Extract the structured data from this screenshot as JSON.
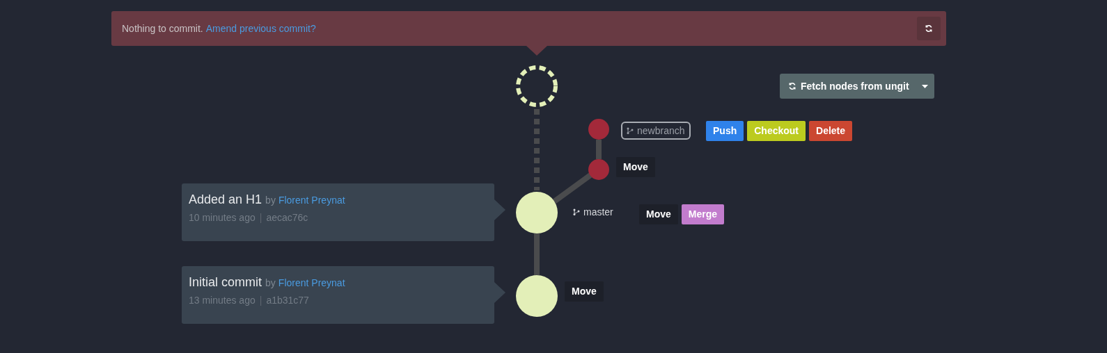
{
  "banner": {
    "text": "Nothing to commit.",
    "link": "Amend previous commit?"
  },
  "fetch_button": {
    "label": "Fetch nodes from ungit"
  },
  "nodes": [
    {
      "kind": "placeholder",
      "color": "#e3efb8"
    },
    {
      "kind": "commit",
      "color": "#a3293a"
    },
    {
      "kind": "commit",
      "color": "#a3293a"
    },
    {
      "kind": "commit",
      "color": "#e3efb8"
    },
    {
      "kind": "commit",
      "color": "#e3efb8"
    }
  ],
  "node_actions": [
    {
      "buttons": [
        {
          "kind": "move",
          "label": "Move"
        }
      ]
    },
    {
      "buttons": [
        {
          "kind": "move",
          "label": "Move"
        }
      ]
    }
  ],
  "branches": [
    {
      "name": "newbranch",
      "highlighted": true,
      "buttons": [
        {
          "kind": "push",
          "label": "Push"
        },
        {
          "kind": "checkout",
          "label": "Checkout"
        },
        {
          "kind": "delete",
          "label": "Delete"
        }
      ]
    },
    {
      "name": "master",
      "highlighted": false,
      "buttons": [
        {
          "kind": "move",
          "label": "Move"
        },
        {
          "kind": "merge",
          "label": "Merge"
        }
      ]
    }
  ],
  "commits": [
    {
      "title": "Added an H1",
      "by": "by",
      "author": "Florent Preynat",
      "time": "10 minutes ago",
      "separator": "|",
      "hash": "aecac76c"
    },
    {
      "title": "Initial commit",
      "by": "by",
      "author": "Florent Preynat",
      "time": "13 minutes ago",
      "separator": "|",
      "hash": "a1b31c77"
    }
  ]
}
